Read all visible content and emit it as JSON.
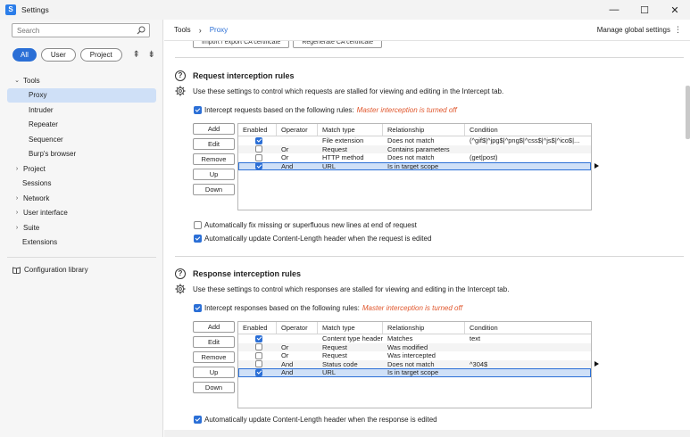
{
  "window": {
    "app_icon": "S",
    "title": "Settings",
    "controls": [
      "—",
      "☐",
      "✕"
    ]
  },
  "sidebar": {
    "search_placeholder": "Search",
    "filters": [
      "All",
      "User",
      "Project"
    ],
    "nav": [
      {
        "label": "Tools",
        "type": "parent",
        "expanded": true
      },
      {
        "label": "Proxy",
        "type": "child",
        "selected": true
      },
      {
        "label": "Intruder",
        "type": "child"
      },
      {
        "label": "Repeater",
        "type": "child"
      },
      {
        "label": "Sequencer",
        "type": "child"
      },
      {
        "label": "Burp's browser",
        "type": "child"
      },
      {
        "label": "Project",
        "type": "parent",
        "expanded": false
      },
      {
        "label": "Sessions",
        "type": "plain"
      },
      {
        "label": "Network",
        "type": "parent",
        "expanded": false
      },
      {
        "label": "User interface",
        "type": "parent",
        "expanded": false
      },
      {
        "label": "Suite",
        "type": "parent",
        "expanded": false
      },
      {
        "label": "Extensions",
        "type": "plain"
      }
    ],
    "config_library": "Configuration library"
  },
  "header": {
    "breadcrumb_root": "Tools",
    "breadcrumb_current": "Proxy",
    "manage_global": "Manage global settings"
  },
  "partial_buttons": [
    "Import / export CA certificate",
    "Regenerate CA certificate"
  ],
  "request_rules": {
    "title": "Request interception rules",
    "description": "Use these settings to control which requests are stalled for viewing and editing in the Intercept tab.",
    "intercept_label": "Intercept requests based on the following rules:",
    "warning": "Master interception is turned off",
    "buttons": [
      "Add",
      "Edit",
      "Remove",
      "Up",
      "Down"
    ],
    "columns": [
      "Enabled",
      "Operator",
      "Match type",
      "Relationship",
      "Condition"
    ],
    "rows": [
      {
        "enabled": true,
        "operator": "",
        "match_type": "File extension",
        "relationship": "Does not match",
        "condition": "(^gif$|^jpg$|^png$|^css$|^js$|^ico$|..."
      },
      {
        "enabled": false,
        "operator": "Or",
        "match_type": "Request",
        "relationship": "Contains parameters",
        "condition": ""
      },
      {
        "enabled": false,
        "operator": "Or",
        "match_type": "HTTP method",
        "relationship": "Does not match",
        "condition": "(get|post)"
      },
      {
        "enabled": true,
        "operator": "And",
        "match_type": "URL",
        "relationship": "Is in target scope",
        "condition": "",
        "selected": true
      }
    ],
    "option_fix_newlines": "Automatically fix missing or superfluous new lines at end of request",
    "option_fix_newlines_checked": false,
    "option_update_length": "Automatically update Content-Length header when the request is edited",
    "option_update_length_checked": true
  },
  "response_rules": {
    "title": "Response interception rules",
    "description": "Use these settings to control which responses are stalled for viewing and editing in the Intercept tab.",
    "intercept_label": "Intercept responses based on the following rules:",
    "warning": "Master interception is turned off",
    "buttons": [
      "Add",
      "Edit",
      "Remove",
      "Up",
      "Down"
    ],
    "columns": [
      "Enabled",
      "Operator",
      "Match type",
      "Relationship",
      "Condition"
    ],
    "rows": [
      {
        "enabled": true,
        "operator": "",
        "match_type": "Content type header",
        "relationship": "Matches",
        "condition": "text"
      },
      {
        "enabled": false,
        "operator": "Or",
        "match_type": "Request",
        "relationship": "Was modified",
        "condition": ""
      },
      {
        "enabled": false,
        "operator": "Or",
        "match_type": "Request",
        "relationship": "Was intercepted",
        "condition": ""
      },
      {
        "enabled": false,
        "operator": "And",
        "match_type": "Status code",
        "relationship": "Does not match",
        "condition": "^304$"
      },
      {
        "enabled": true,
        "operator": "And",
        "match_type": "URL",
        "relationship": "Is in target scope",
        "condition": "",
        "selected": true
      }
    ],
    "option_update_length": "Automatically update Content-Length header when the response is edited",
    "option_update_length_checked": true
  },
  "colors": {
    "accent": "#2b6fd6",
    "warning": "#e0562c",
    "selection": "#cfe0f7"
  }
}
